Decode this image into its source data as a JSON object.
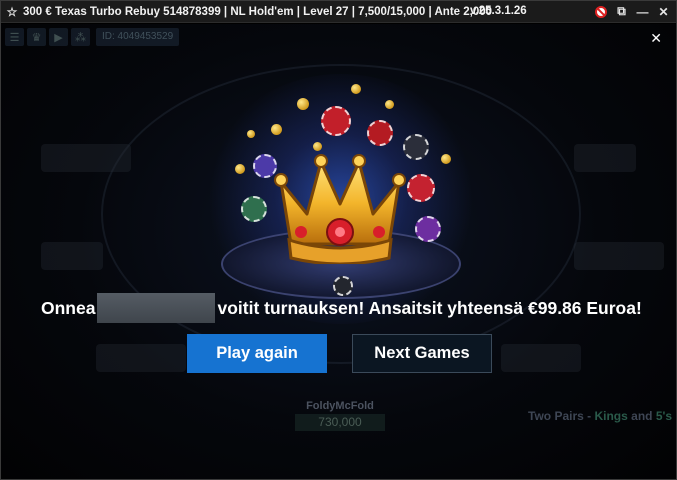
{
  "window": {
    "title": "300 € Texas Turbo Rebuy 514878399 | NL Hold'em | Level 27 | 7,500/15,000 | Ante 2,000",
    "version": "v.25.3.1.26"
  },
  "toolbar": {
    "id_label": "ID: 4049453529",
    "icons": [
      "menu-icon",
      "trophy-icon",
      "play-icon",
      "network-icon"
    ]
  },
  "table": {
    "player_name": "FoldyMcFold",
    "player_stack": "730,000",
    "hand": {
      "prefix": "Two Pairs - ",
      "first": "Kings",
      "and": " and ",
      "second": "5's"
    }
  },
  "dialog": {
    "message_start": "Onnea",
    "message_end": "voitit turnauksen! Ansaitsit yhteensä €99.86 Euroa!",
    "play_again_label": "Play again",
    "next_games_label": "Next Games",
    "accent_color": "#1673d1"
  }
}
